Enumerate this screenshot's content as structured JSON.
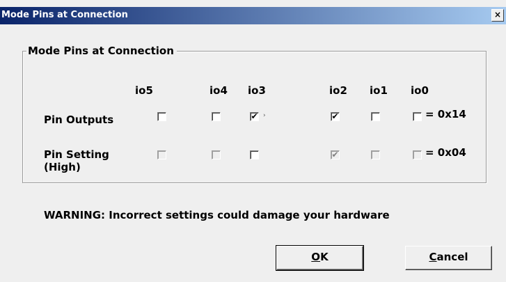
{
  "window": {
    "title": "Mode Pins at Connection",
    "close_glyph": "×"
  },
  "group": {
    "legend": "Mode Pins at Connection"
  },
  "columns": [
    "io5",
    "io4",
    "io3",
    "io2",
    "io1",
    "io0"
  ],
  "rows": [
    {
      "label": "Pin Outputs",
      "label_line2": "",
      "checks": [
        false,
        false,
        true,
        true,
        false,
        false
      ],
      "enabled": [
        true,
        true,
        true,
        true,
        true,
        true
      ],
      "hex": "= 0x14"
    },
    {
      "label": "Pin Setting",
      "label_line2": "(High)",
      "checks": [
        false,
        false,
        false,
        true,
        false,
        false
      ],
      "enabled": [
        false,
        false,
        true,
        false,
        false,
        false
      ],
      "hex": "= 0x04"
    }
  ],
  "marker": "›",
  "warning": "WARNING: Incorrect settings could damage your hardware",
  "buttons": {
    "ok_mnemonic": "O",
    "ok_rest": "K",
    "cancel_mnemonic": "C",
    "cancel_rest": "ancel"
  }
}
